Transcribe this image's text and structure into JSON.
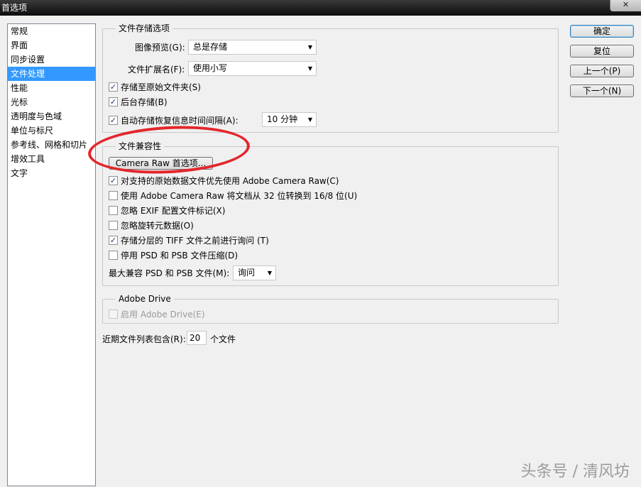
{
  "window": {
    "title": "首选项",
    "close_glyph": "✕"
  },
  "sidebar": {
    "items": [
      {
        "label": "常规"
      },
      {
        "label": "界面"
      },
      {
        "label": "同步设置"
      },
      {
        "label": "文件处理",
        "selected": true
      },
      {
        "label": "性能"
      },
      {
        "label": "光标"
      },
      {
        "label": "透明度与色域"
      },
      {
        "label": "单位与标尺"
      },
      {
        "label": "参考线、网格和切片"
      },
      {
        "label": "增效工具"
      },
      {
        "label": "文字"
      }
    ]
  },
  "file_save": {
    "legend": "文件存储选项",
    "image_preview_label": "图像预览(G):",
    "image_preview_value": "总是存储",
    "file_ext_label": "文件扩展名(F):",
    "file_ext_value": "使用小写",
    "save_to_original_label": "存储至原始文件夹(S)",
    "save_to_original_checked": true,
    "background_save_label": "后台存储(B)",
    "background_save_checked": true,
    "auto_save_label": "自动存储恢复信息时间间隔(A):",
    "auto_save_checked": true,
    "auto_save_interval": "10 分钟"
  },
  "compat": {
    "legend": "文件兼容性",
    "camera_raw_button": "Camera Raw 首选项...",
    "options": [
      {
        "label": "对支持的原始数据文件优先使用 Adobe Camera Raw(C)",
        "checked": true
      },
      {
        "label": "使用 Adobe Camera Raw 将文档从 32 位转换到 16/8 位(U)",
        "checked": false
      },
      {
        "label": "忽略 EXIF 配置文件标记(X)",
        "checked": false
      },
      {
        "label": "忽略旋转元数据(O)",
        "checked": false
      },
      {
        "label": "存储分层的 TIFF 文件之前进行询问 (T)",
        "checked": true
      },
      {
        "label": "停用 PSD 和 PSB 文件压缩(D)",
        "checked": false
      }
    ],
    "max_compat_label": "最大兼容 PSD 和 PSB 文件(M):",
    "max_compat_value": "询问"
  },
  "adobe_drive": {
    "legend": "Adobe Drive",
    "enable_label": "启用 Adobe Drive(E)",
    "enable_checked": false
  },
  "recent_files": {
    "label": "近期文件列表包含(R):",
    "value": "20",
    "suffix": "个文件"
  },
  "buttons": {
    "ok": "确定",
    "reset": "复位",
    "prev": "上一个(P)",
    "next": "下一个(N)"
  },
  "watermark": "头条号 / 清风坊",
  "glyphs": {
    "check": "✓",
    "dropdown_arrow": "▼"
  },
  "colors": {
    "selection": "#3399ff",
    "annotation_circle": "#e3262b"
  }
}
